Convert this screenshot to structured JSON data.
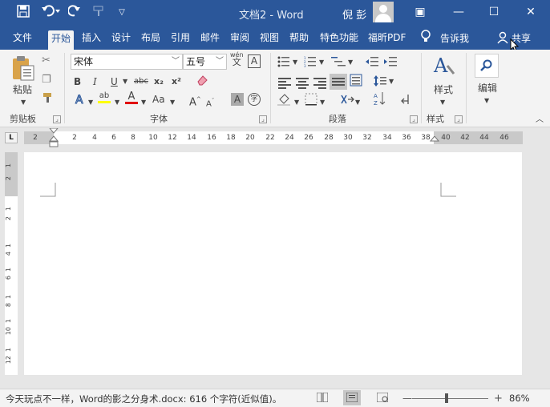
{
  "titlebar": {
    "doc_title": "文档2  -  Word",
    "user_name": "倪 彭",
    "qa_save_icon": "save-icon",
    "qa_undo_icon": "undo-icon",
    "qa_redo_icon": "redo-icon",
    "win_ribbon_opts": "▣",
    "win_min": "—",
    "win_max": "☐",
    "win_close": "✕"
  },
  "tabs": [
    "文件",
    "开始",
    "插入",
    "设计",
    "布局",
    "引用",
    "邮件",
    "审阅",
    "视图",
    "帮助",
    "特色功能",
    "福昕PDF"
  ],
  "tell_me": "告诉我",
  "share": "共享",
  "ribbon": {
    "clipboard": {
      "paste": "粘贴",
      "label": "剪贴板"
    },
    "font": {
      "name": "宋体",
      "size": "五号",
      "label": "字体",
      "bold": "B",
      "italic": "I",
      "underline": "U",
      "strike": "abc",
      "sub": "x₂",
      "sup": "x²",
      "highlight": "ab",
      "color": "A",
      "case": "Aa",
      "grow": "A",
      "shrink": "A",
      "char_shading": "A",
      "enclose": "字",
      "clear": "A",
      "phonetic_top": "wén",
      "phonetic_bottom": "文",
      "border_char": "A"
    },
    "paragraph": {
      "label": "段落"
    },
    "styles": {
      "btn": "样式",
      "label": "样式"
    },
    "editing": {
      "btn": "编辑"
    }
  },
  "ruler": {
    "corner": "L",
    "ticks": [
      "2",
      "2",
      "4",
      "6",
      "8",
      "10",
      "12",
      "14",
      "16",
      "18",
      "20",
      "22",
      "24",
      "26",
      "28",
      "30",
      "32",
      "34",
      "36",
      "38",
      "40",
      "42",
      "44",
      "46"
    ],
    "vticks": [
      "1",
      "2",
      "1",
      "2",
      "1",
      "4",
      "1",
      "6",
      "1",
      "8",
      "1",
      "10",
      "1",
      "12"
    ]
  },
  "status": {
    "text": "今天玩点不一样，Word的影之分身术.docx: 616 个字符(近似值)。",
    "zoom": "86%",
    "zoom_level": 0.43
  },
  "colors": {
    "brand": "#2b579a",
    "highlight_yellow": "#ffff00",
    "font_red": "#e00000"
  }
}
